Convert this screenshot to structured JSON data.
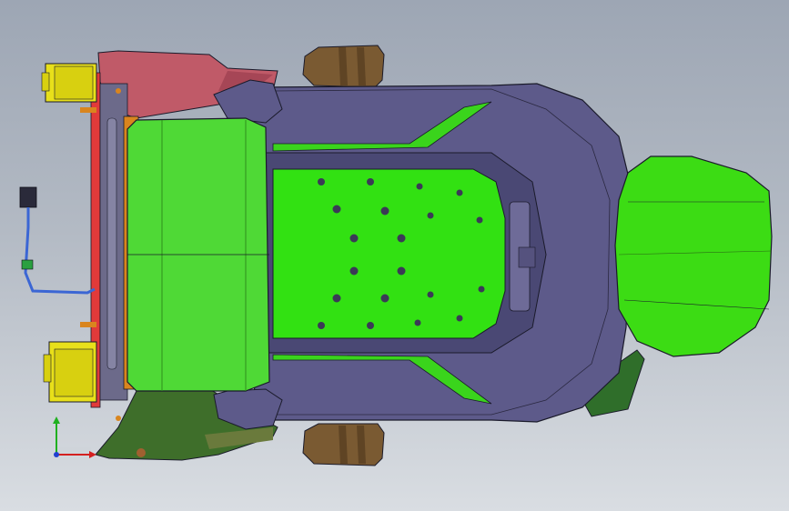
{
  "viewport": {
    "background_top": "#9da6b4",
    "background_bottom": "#d9dde2"
  },
  "model": {
    "backrest_color": "#4fd936",
    "cushion_color": "#32e112",
    "headrest_color": "#3cdc14",
    "shell_color": "#5d5a8a",
    "armrest_red_color": "#c05a68",
    "armrest_green_color": "#3e6e2a",
    "frame_red_color": "#e13a3a",
    "frame_orange_color": "#d9851e",
    "bracket_yellow_color": "#e8e01a",
    "pad_brown_color": "#7a5a32",
    "cable_blue_color": "#3b66d4",
    "edge_color": "#1a1a2a"
  },
  "triad": {
    "x_axis_color": "#d42020",
    "y_axis_color": "#20b020",
    "z_axis_color": "#2040d0",
    "x_label": "",
    "y_label": "",
    "z_label": ""
  }
}
